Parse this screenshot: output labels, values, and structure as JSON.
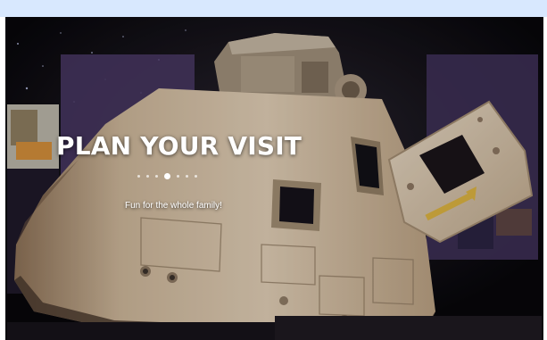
{
  "hero": {
    "title": "PLAN YOUR VISIT",
    "tagline": "Fun for the whole family!",
    "slider": {
      "slide_count": 7,
      "active_index": 3
    }
  },
  "colors": {
    "top_band": "#d8e8fe",
    "background": "#08070a",
    "capsule": "#c9b79e",
    "text": "#ffffff"
  }
}
